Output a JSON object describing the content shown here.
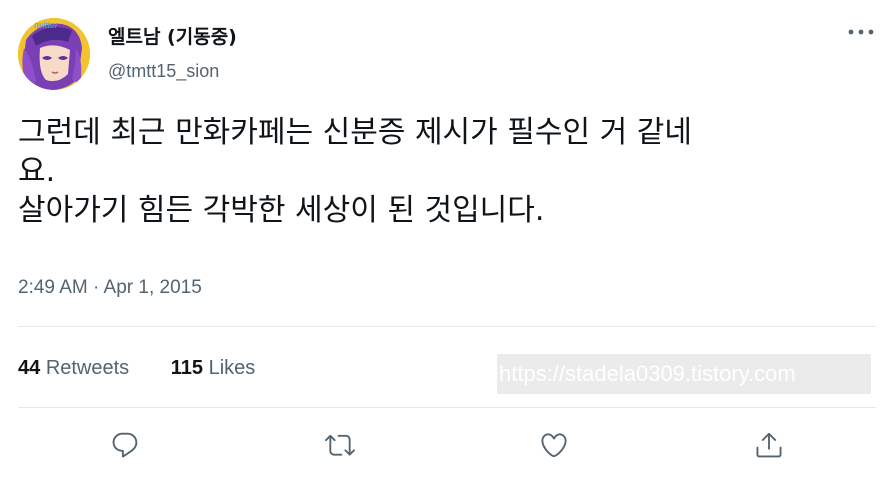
{
  "author": {
    "display_name": "엘트남 (기동중)",
    "handle": "@tmtt15_sion",
    "avatar_text": "twitter"
  },
  "tweet": {
    "lines": [
      "그런데 최근 만화카페는 신분증 제시가 필수인 거 같네",
      "요.",
      "살아가기 힘든 각박한 세상이 된 것입니다."
    ],
    "timestamp": "2:49 AM · Apr 1, 2015"
  },
  "stats": {
    "retweets_count": "44",
    "retweets_label": "Retweets",
    "likes_count": "115",
    "likes_label": "Likes"
  },
  "watermark": "https://stadela0309.tistory.com",
  "icons": {
    "more": "more-icon",
    "reply": "reply-icon",
    "retweet": "retweet-icon",
    "like": "heart-icon",
    "share": "share-icon"
  },
  "colors": {
    "text": "#0f1419",
    "secondary": "#536471",
    "divider": "#e1e8ed"
  }
}
